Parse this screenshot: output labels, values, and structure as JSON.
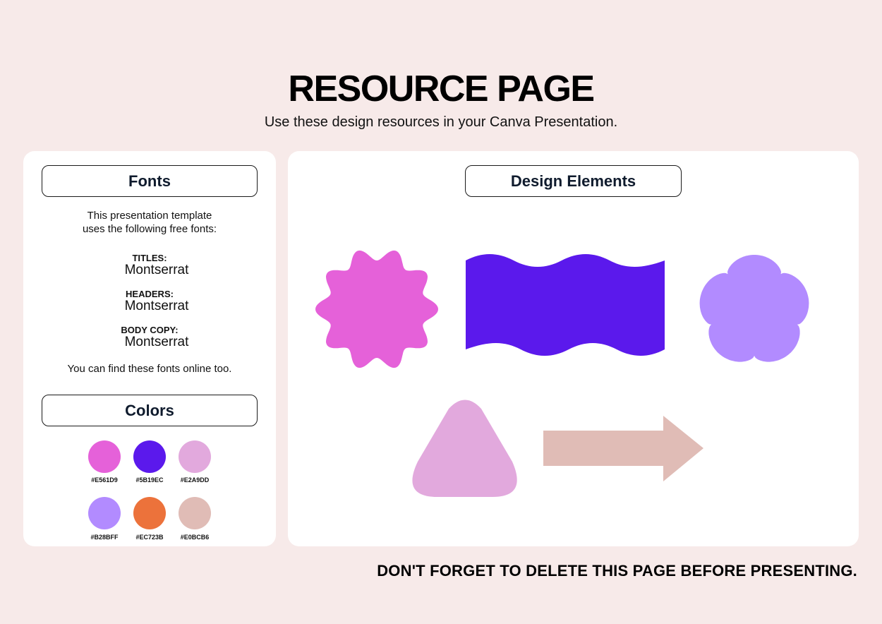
{
  "title": "RESOURCE PAGE",
  "subtitle": "Use these design resources in your Canva Presentation.",
  "fonts_panel": {
    "heading": "Fonts",
    "intro_line1": "This presentation template",
    "intro_line2": "uses the following free fonts:",
    "items": [
      {
        "label": "TITLES:",
        "font": "Montserrat"
      },
      {
        "label": "HEADERS:",
        "font": "Montserrat"
      },
      {
        "label": "BODY COPY:",
        "font": "Montserrat"
      }
    ],
    "note": "You can find these fonts online too."
  },
  "colors_panel": {
    "heading": "Colors",
    "swatches": [
      {
        "hex": "#E561D9",
        "color": "#E561D9"
      },
      {
        "hex": "#5B19EC",
        "color": "#5B19EC"
      },
      {
        "hex": "#E2A9DD",
        "color": "#E2A9DD"
      },
      {
        "hex": "#B28BFF",
        "color": "#B28BFF"
      },
      {
        "hex": "#EC723B",
        "color": "#EC723B"
      },
      {
        "hex": "#E0BCB6",
        "color": "#E0BCB6"
      }
    ]
  },
  "design_panel": {
    "heading": "Design Elements",
    "elements": [
      {
        "shape": "wavy-circle",
        "color": "#E561D9"
      },
      {
        "shape": "wavy-banner",
        "color": "#5B19EC"
      },
      {
        "shape": "flower",
        "color": "#B28BFF"
      },
      {
        "shape": "rounded-triangle",
        "color": "#E2A9DD"
      },
      {
        "shape": "arrow-right",
        "color": "#E0BCB6"
      }
    ]
  },
  "footer": "DON'T FORGET TO DELETE THIS PAGE BEFORE PRESENTING."
}
